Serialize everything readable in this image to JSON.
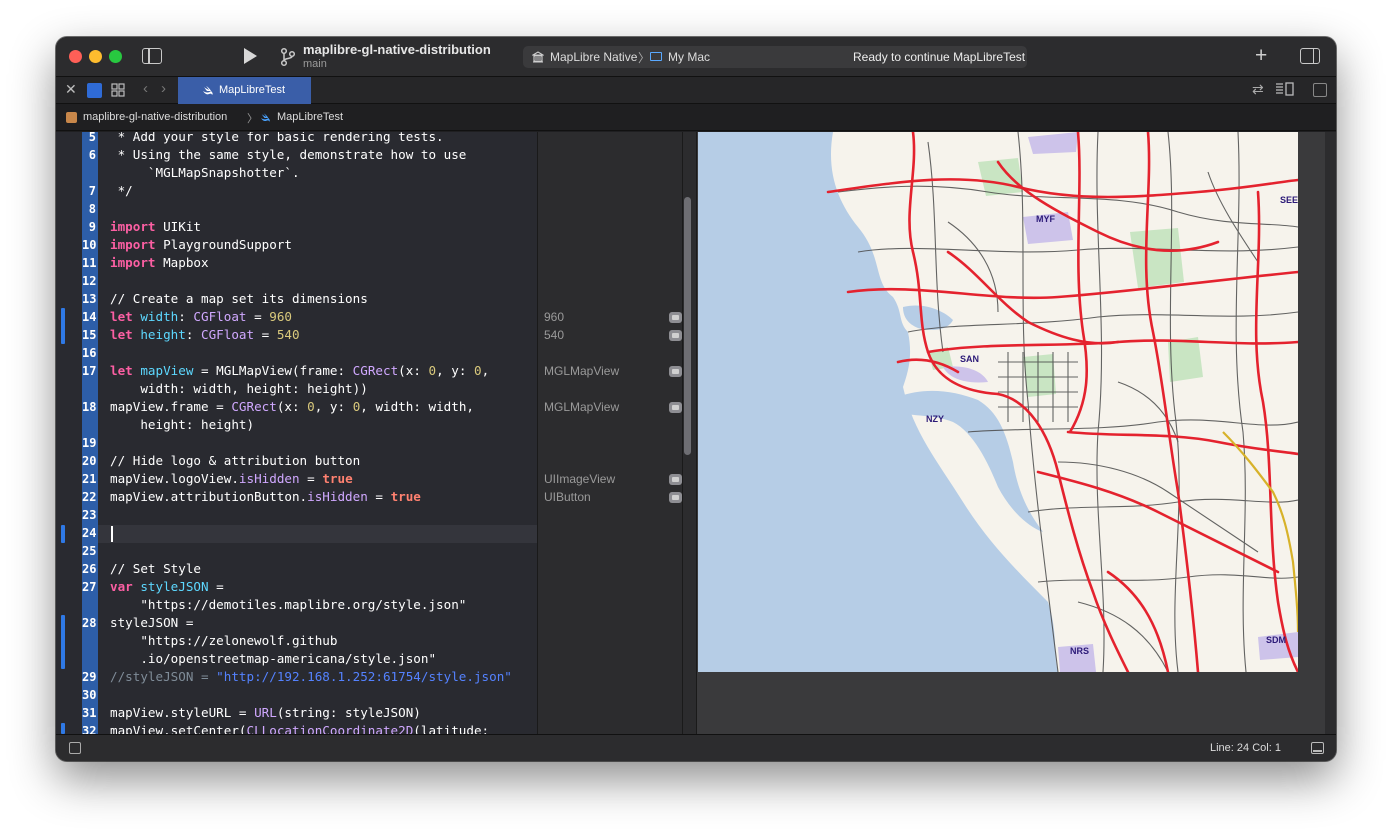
{
  "titlebar": {
    "project_name": "maplibre-gl-native-distribution",
    "branch": "main",
    "scheme": "MapLibre Native",
    "scheme_chevron": "〉",
    "destination": "My Mac",
    "status": "Ready to continue MapLibreTest",
    "add_label": "+"
  },
  "tabbar": {
    "close_glyph": "✕",
    "back_glyph": "‹",
    "forward_glyph": "›",
    "active_tab": "MapLibreTest",
    "swap_glyph": "⇄"
  },
  "breadcrumb": {
    "project": "maplibre-gl-native-distribution",
    "separator": "〉",
    "file": "MapLibreTest"
  },
  "editor": {
    "line_numbers": [
      "5",
      "6",
      "7",
      "8",
      "9",
      "10",
      "11",
      "12",
      "13",
      "14",
      "15",
      "16",
      "17",
      "18",
      "19",
      "20",
      "21",
      "22",
      "23",
      "24",
      "25",
      "26",
      "27",
      "28",
      "29",
      "30",
      "31",
      "32"
    ],
    "tokens": {
      "l5": " * Add your style for basic rendering tests.",
      "l6": " * Using the same style, demonstrate how to use",
      "l6b": "     `MGLMapSnapshotter`.",
      "l7": " */",
      "l9_kw": "import",
      "l9_mod": " UIKit",
      "l10_kw": "import",
      "l10_mod": " PlaygroundSupport",
      "l11_kw": "import",
      "l11_mod": " Mapbox",
      "l13": "// Create a map set its dimensions",
      "l14_kw": "let",
      "l14_id": " width",
      "l14_c": ": ",
      "l14_type": "CGFloat",
      "l14_eq": " = ",
      "l14_num": "960",
      "l15_kw": "let",
      "l15_id": " height",
      "l15_c": ": ",
      "l15_type": "CGFloat",
      "l15_eq": " = ",
      "l15_num": "540",
      "l17_kw": "let",
      "l17_id": " mapView",
      "l17_a": " = MGLMapView(frame: ",
      "l17_type": "CGRect",
      "l17_b": "(x: ",
      "l17_n1": "0",
      "l17_c": ", y: ",
      "l17_n2": "0",
      "l17_d": ",",
      "l17b": "    width: width, height: height))",
      "l18_a": "mapView.frame = ",
      "l18_type": "CGRect",
      "l18_b": "(x: ",
      "l18_n1": "0",
      "l18_c": ", y: ",
      "l18_n2": "0",
      "l18_d": ", width: width,",
      "l18b": "    height: height)",
      "l20": "// Hide logo & attribution button",
      "l21_a": "mapView.logoView.",
      "l21_prop": "isHidden",
      "l21_b": " = ",
      "l21_lit": "true",
      "l22_a": "mapView.attributionButton.",
      "l22_prop": "isHidden",
      "l22_b": " = ",
      "l22_lit": "true",
      "l26": "// Set Style",
      "l27_kw": "var",
      "l27_id": " styleJSON",
      "l27_b": " =",
      "l27b_str": "    \"https://demotiles.maplibre.org/style.json\"",
      "l28_a": "styleJSON =",
      "l28b_str": "    \"https://zelonewolf.github",
      "l28c_str": "    .io/openstreetmap-americana/style.json\"",
      "l29_cmt": "//styleJSON = ",
      "l29_url": "\"http://192.168.1.252:61754/style.json\"",
      "l31_a": "mapView.styleURL = ",
      "l31_type": "URL",
      "l31_b": "(string: styleJSON)",
      "l32_a": "mapView.setCenter(",
      "l32_type": "CLLocationCoordinate2D",
      "l32_b": "(latitude:"
    }
  },
  "results": {
    "width": "960",
    "height": "540",
    "map_view_1": "MGLMapView",
    "map_view_2": "MGLMapView",
    "logo_view": "UIImageView",
    "attribution_button": "UIButton"
  },
  "map": {
    "labels": {
      "myf": "MYF",
      "see": "SEE",
      "san": "SAN",
      "nzy": "NZY",
      "sdm": "SDM",
      "nrs": "NRS"
    },
    "colors": {
      "land": "#f6f3ec",
      "water": "#b6cde6",
      "motorway": "#e4222e",
      "road": "#4a4a4a",
      "park": "#c9e5c3",
      "airport": "#cdc3ea",
      "airport_label": "#2c1a78",
      "trunk_yellow": "#d7b22a"
    }
  },
  "statusbar": {
    "position": "Line: 24  Col: 1"
  }
}
